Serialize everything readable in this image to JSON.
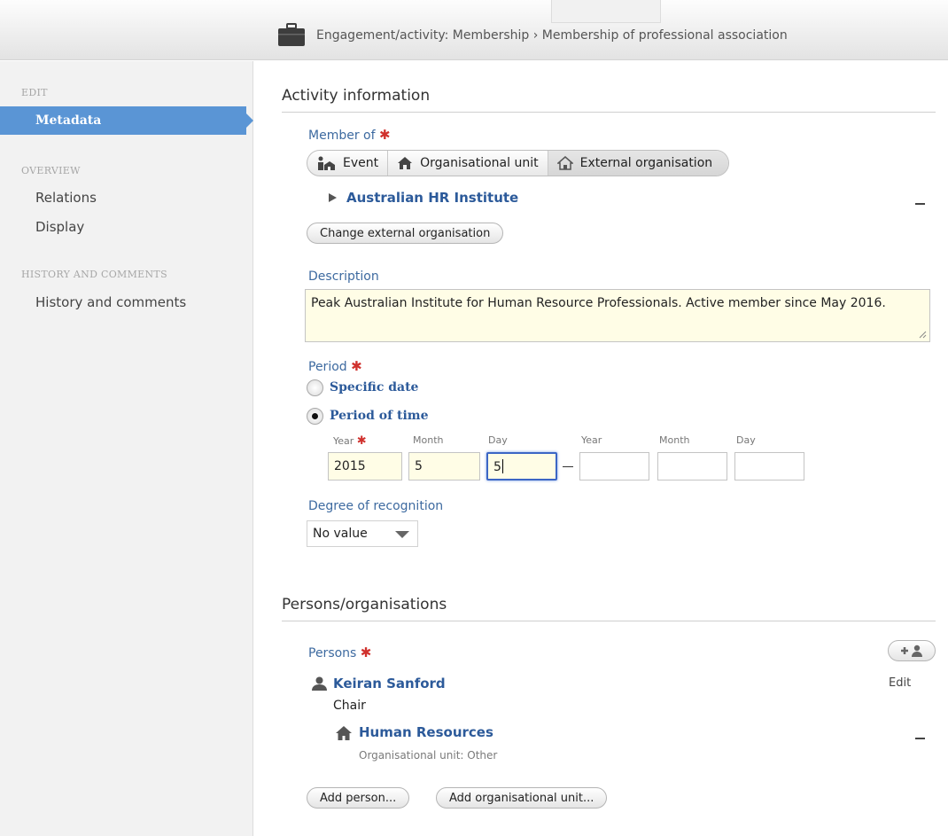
{
  "header": {
    "breadcrumb": "Engagement/activity: Membership › Membership of professional association",
    "icon": "briefcase-icon"
  },
  "sidebar": {
    "edit_heading": "EDIT",
    "active_item": "Metadata",
    "overview_heading": "OVERVIEW",
    "overview_items": [
      "Relations",
      "Display"
    ],
    "history_heading": "HISTORY AND COMMENTS",
    "history_items": [
      "History and comments"
    ]
  },
  "activity": {
    "title": "Activity information",
    "member_of_label": "Member of",
    "required_mark": "✱",
    "member_types": [
      "Event",
      "Organisational unit",
      "External organisation"
    ],
    "selected_type": "External organisation",
    "member_name": "Australian HR Institute",
    "change_button": "Change external organisation",
    "description_label": "Description",
    "description_value": "Peak Australian Institute for Human Resource Professionals. Active member since May 2016.",
    "period_label": "Period",
    "period_options": [
      "Specific date",
      "Period of time"
    ],
    "period_selected": "Period of time",
    "date_headers": [
      "Year",
      "Month",
      "Day",
      "Year",
      "Month",
      "Day"
    ],
    "start_year": "2015",
    "start_month": "5",
    "start_day": "5",
    "end_year": "",
    "end_month": "",
    "end_day": "",
    "recognition_label": "Degree of recognition",
    "recognition_value": "No value"
  },
  "persons": {
    "title": "Persons/organisations",
    "persons_label": "Persons",
    "edit_label": "Edit",
    "person_name": "Keiran Sanford",
    "person_role": "Chair",
    "org_name": "Human Resources",
    "org_type": "Organisational unit: Other",
    "add_person_button": "Add person...",
    "add_org_button": "Add organisational unit..."
  },
  "colors": {
    "accent": "#5a95d5",
    "link": "#2c5a9a",
    "required": "#d0312d",
    "field_fill": "#fffde6"
  }
}
